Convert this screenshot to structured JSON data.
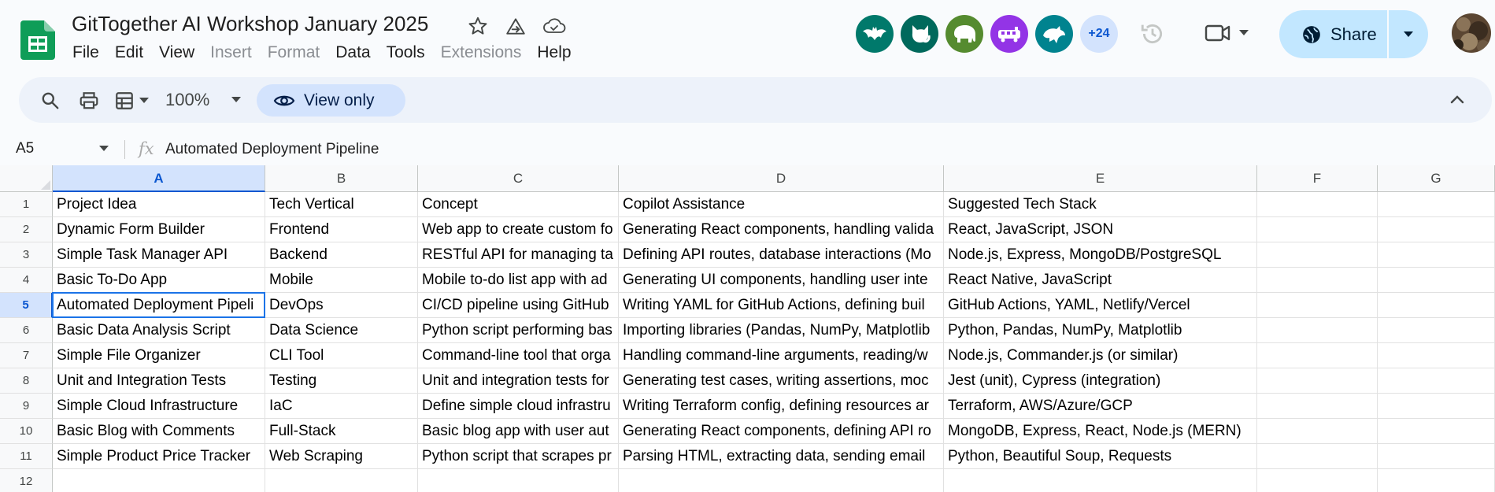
{
  "document": {
    "title": "GitTogether AI Workshop January 2025"
  },
  "title_icons": [
    "star-icon",
    "move-to-folder-icon",
    "cloud-status-icon"
  ],
  "menu": [
    {
      "label": "File",
      "disabled": false
    },
    {
      "label": "Edit",
      "disabled": false
    },
    {
      "label": "View",
      "disabled": false
    },
    {
      "label": "Insert",
      "disabled": true
    },
    {
      "label": "Format",
      "disabled": true
    },
    {
      "label": "Data",
      "disabled": false
    },
    {
      "label": "Tools",
      "disabled": false
    },
    {
      "label": "Extensions",
      "disabled": true
    },
    {
      "label": "Help",
      "disabled": false
    }
  ],
  "collaborators": [
    {
      "animal": "bat",
      "color": "#00796b"
    },
    {
      "animal": "cat",
      "color": "#00695c"
    },
    {
      "animal": "elephant",
      "color": "#558b2f"
    },
    {
      "animal": "train",
      "color": "#9334e6"
    },
    {
      "animal": "dragon",
      "color": "#00838f"
    }
  ],
  "collaborators_more": "+24",
  "share": {
    "label": "Share"
  },
  "toolbar": {
    "zoom": "100%",
    "view_only_label": "View only"
  },
  "formula_bar": {
    "cell_ref": "A5",
    "fx": "fx",
    "content": "Automated Deployment Pipeline"
  },
  "sheet": {
    "columns": [
      "A",
      "B",
      "C",
      "D",
      "E",
      "F",
      "G"
    ],
    "active_column": "A",
    "active_row": "5",
    "rows": [
      {
        "num": "1",
        "cells": [
          "Project Idea",
          "Tech Vertical",
          "Concept",
          "Copilot Assistance",
          "Suggested Tech Stack",
          "",
          ""
        ]
      },
      {
        "num": "2",
        "cells": [
          "Dynamic Form Builder",
          "Frontend",
          "Web app to create custom fo",
          "Generating React components, handling valida",
          "React, JavaScript, JSON",
          "",
          ""
        ]
      },
      {
        "num": "3",
        "cells": [
          "Simple Task Manager API",
          "Backend",
          "RESTful API for managing ta",
          "Defining API routes, database interactions (Mo",
          "Node.js, Express, MongoDB/PostgreSQL",
          "",
          ""
        ]
      },
      {
        "num": "4",
        "cells": [
          "Basic To-Do App",
          "Mobile",
          "Mobile to-do list app with ad",
          "Generating UI components, handling user inte",
          "React Native, JavaScript",
          "",
          ""
        ]
      },
      {
        "num": "5",
        "cells": [
          "Automated Deployment Pipeli",
          "DevOps",
          "CI/CD pipeline using GitHub",
          "Writing YAML for GitHub Actions, defining buil",
          "GitHub Actions, YAML, Netlify/Vercel",
          "",
          ""
        ]
      },
      {
        "num": "6",
        "cells": [
          "Basic Data Analysis Script",
          "Data Science",
          "Python script performing bas",
          "Importing libraries (Pandas, NumPy, Matplotlib",
          "Python, Pandas, NumPy, Matplotlib",
          "",
          ""
        ]
      },
      {
        "num": "7",
        "cells": [
          "Simple File Organizer",
          "CLI Tool",
          "Command-line tool that orga",
          "Handling command-line arguments, reading/w",
          "Node.js, Commander.js (or similar)",
          "",
          ""
        ]
      },
      {
        "num": "8",
        "cells": [
          "Unit and Integration Tests",
          "Testing",
          "Unit and integration tests for",
          "Generating test cases, writing assertions, moc",
          "Jest (unit), Cypress (integration)",
          "",
          ""
        ]
      },
      {
        "num": "9",
        "cells": [
          "Simple Cloud Infrastructure",
          "IaC",
          "Define simple cloud infrastru",
          "Writing Terraform config, defining resources ar",
          "Terraform, AWS/Azure/GCP",
          "",
          ""
        ]
      },
      {
        "num": "10",
        "cells": [
          "Basic Blog with Comments",
          "Full-Stack",
          "Basic blog app with user aut",
          "Generating React components, defining API ro",
          "MongoDB, Express, React, Node.js (MERN)",
          "",
          ""
        ]
      },
      {
        "num": "11",
        "cells": [
          "Simple Product Price Tracker",
          "Web Scraping",
          "Python script that scrapes pr",
          "Parsing HTML, extracting data, sending email",
          "Python, Beautiful Soup, Requests",
          "",
          ""
        ]
      },
      {
        "num": "12",
        "cells": [
          "",
          "",
          "",
          "",
          "",
          "",
          ""
        ]
      }
    ]
  }
}
